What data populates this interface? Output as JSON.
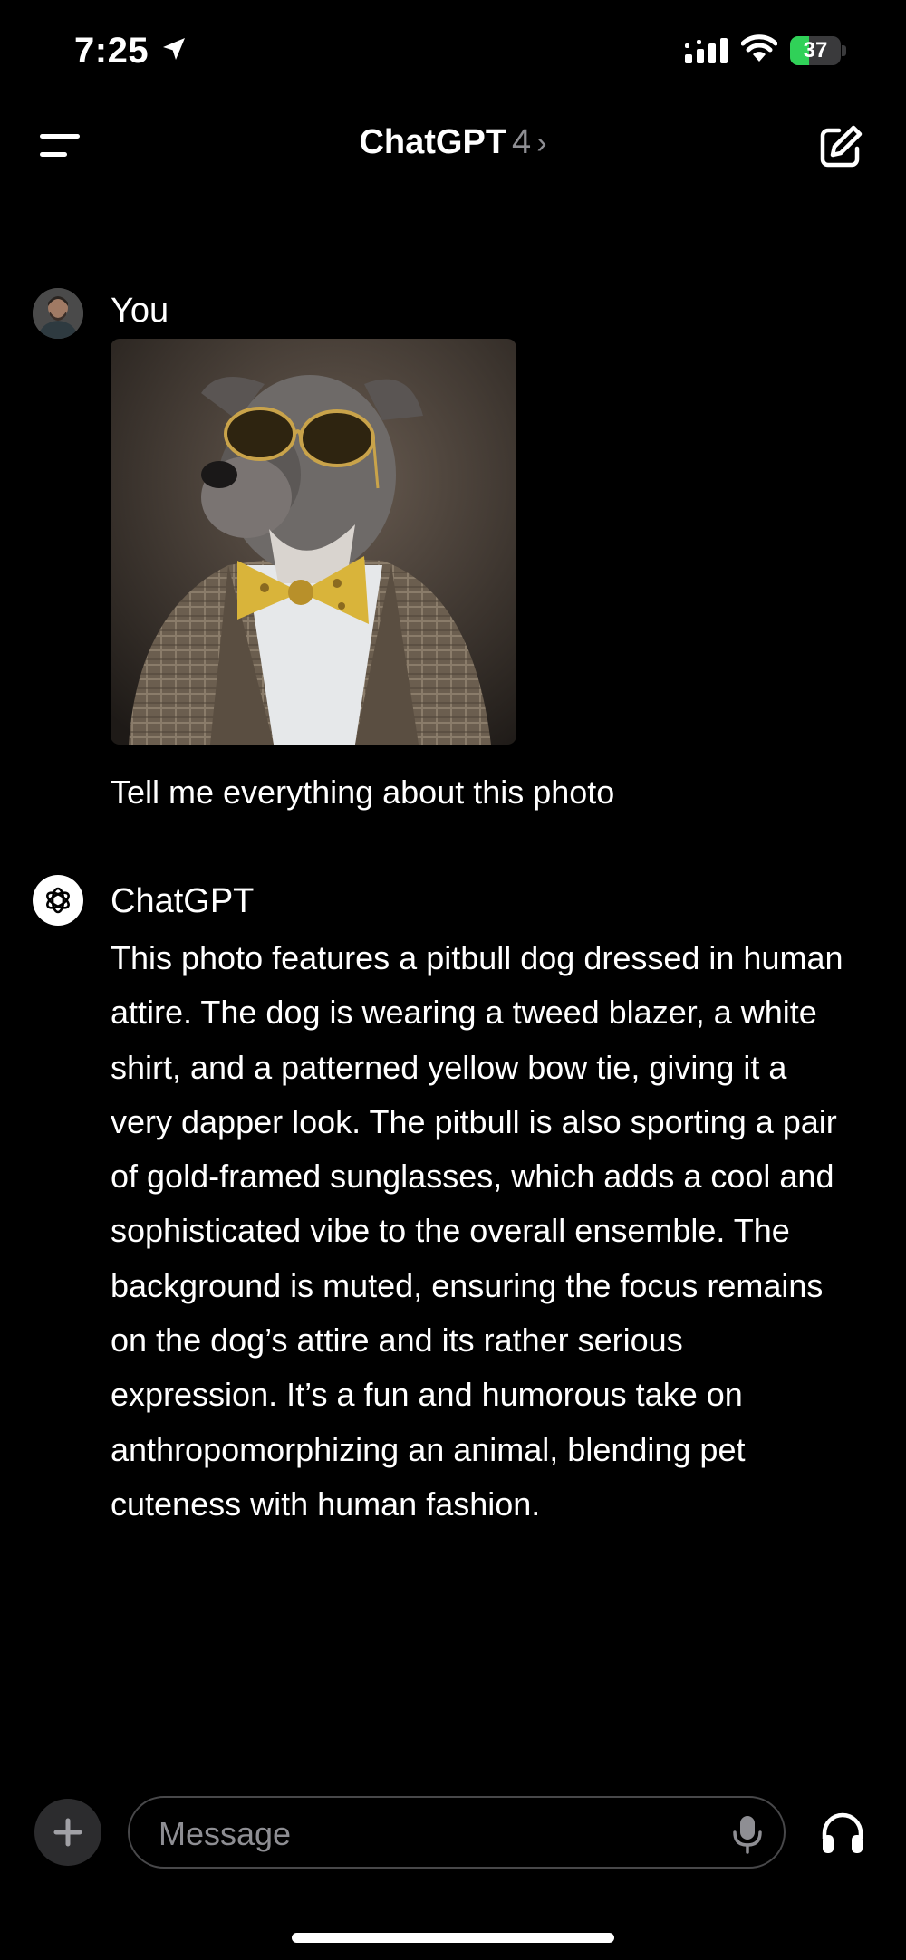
{
  "status_bar": {
    "time": "7:25",
    "battery_level": "37",
    "battery_fraction": 0.37,
    "icons": [
      "location-arrow-icon",
      "cellular-signal-icon",
      "wifi-icon",
      "battery-icon"
    ]
  },
  "nav": {
    "title": "ChatGPT",
    "model_version": "4",
    "chevron": "›",
    "left_icon": "menu-icon",
    "right_icon": "compose-icon"
  },
  "conversation": {
    "user": {
      "name": "You",
      "attachment_icon": "image-icon",
      "message": "Tell me everything about this photo"
    },
    "assistant": {
      "name": "ChatGPT",
      "message": "This photo features a pitbull dog dressed in human attire. The dog is wearing a tweed blazer, a white shirt, and a patterned yellow bow tie, giving it a very dapper look. The pitbull is also sporting a pair of gold-framed sunglasses, which adds a cool and sophisticated vibe to the overall ensemble. The background is muted, ensuring the focus remains on the dog’s attire and its rather serious expression. It’s a fun and humorous take on anthropomorphizing an animal, blending pet cuteness with human fashion."
    }
  },
  "composer": {
    "placeholder": "Message",
    "value": "",
    "icons": [
      "plus-icon",
      "microphone-icon",
      "headphones-icon"
    ]
  },
  "colors": {
    "background": "#000000",
    "text": "#ffffff",
    "muted": "#8e8e93",
    "battery_green": "#30d158",
    "input_border": "#48484a"
  }
}
